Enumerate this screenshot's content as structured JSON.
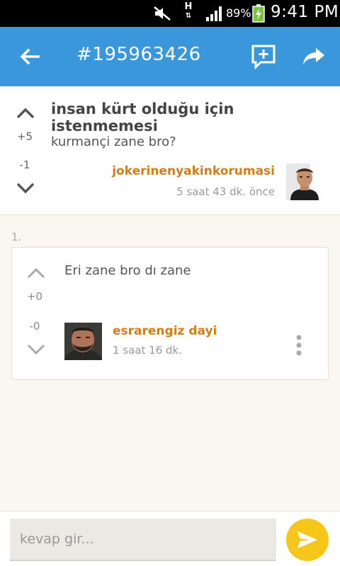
{
  "status_bar": {
    "network_type": "H",
    "battery_percent": "89%",
    "time": "9:41 PM",
    "icons": [
      "mute-icon",
      "network-h-icon",
      "signal-icon",
      "battery-charging-icon"
    ]
  },
  "action_bar": {
    "title": "#195963426",
    "icons": [
      "back-arrow-icon",
      "add-comment-icon",
      "share-icon"
    ],
    "color": "#3a97dc"
  },
  "post": {
    "title": "insan kürt olduğu için istenmemesi",
    "body": "kurmançi zane bro?",
    "score_plus": "+5",
    "score_minus": "-1",
    "author": "jokerinenyakinkorumasi",
    "time": "5 saat 43 dk. önce",
    "author_color": "#d77b14"
  },
  "comments": [
    {
      "index": "1.",
      "body": "Eri zane bro dı zane",
      "score_plus": "+0",
      "score_minus": "-0",
      "author": "esrarengiz dayi",
      "time": "1 saat 16 dk."
    }
  ],
  "reply": {
    "placeholder": "kevap gir...",
    "send_icon": "send-icon",
    "send_color": "#f7c61b"
  }
}
